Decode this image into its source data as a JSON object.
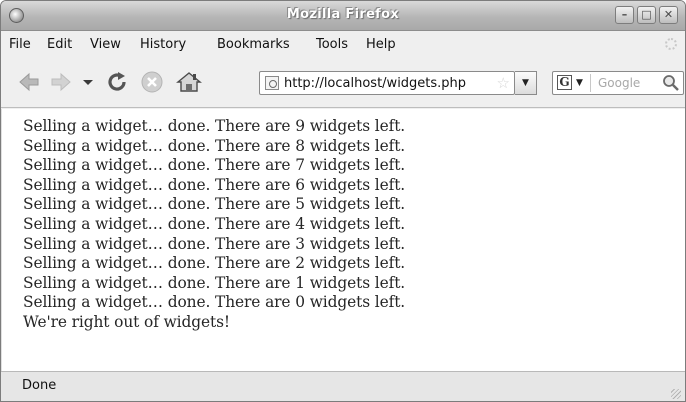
{
  "window": {
    "title": "Mozilla Firefox"
  },
  "menubar": {
    "items": [
      "File",
      "Edit",
      "View",
      "History",
      "Bookmarks",
      "Tools",
      "Help"
    ]
  },
  "navbar": {
    "icons": [
      "back-arrow-icon",
      "forward-arrow-icon",
      "history-dropdown-icon",
      "reload-icon",
      "stop-icon",
      "home-icon"
    ],
    "url": "http://localhost/widgets.php",
    "search_placeholder": "Google"
  },
  "content": {
    "lines": [
      "Selling a widget… done. There are 9 widgets left.",
      "Selling a widget… done. There are 8 widgets left.",
      "Selling a widget… done. There are 7 widgets left.",
      "Selling a widget… done. There are 6 widgets left.",
      "Selling a widget… done. There are 5 widgets left.",
      "Selling a widget… done. There are 4 widgets left.",
      "Selling a widget… done. There are 3 widgets left.",
      "Selling a widget… done. There are 2 widgets left.",
      "Selling a widget… done. There are 1 widgets left.",
      "Selling a widget… done. There are 0 widgets left.",
      "We're right out of widgets!"
    ]
  },
  "statusbar": {
    "text": "Done"
  }
}
